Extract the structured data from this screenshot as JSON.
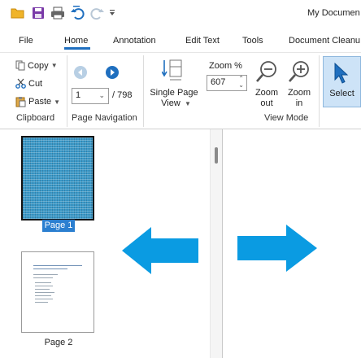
{
  "window": {
    "title": "My Documen"
  },
  "quick_access": [
    "open-folder-icon",
    "save-icon",
    "print-icon",
    "undo-icon",
    "redo-icon",
    "customize-toolbar-icon"
  ],
  "tabs": [
    {
      "label": "File"
    },
    {
      "label": "Home",
      "active": true
    },
    {
      "label": "Annotation"
    },
    {
      "label": "Edit Text"
    },
    {
      "label": "Tools"
    },
    {
      "label": "Document Cleanu"
    }
  ],
  "ribbon": {
    "clipboard": {
      "copy": "Copy",
      "cut": "Cut",
      "paste": "Paste",
      "label": "Clipboard"
    },
    "page_navigation": {
      "current_page": "1",
      "total": "/ 798",
      "label": "Page Navigation"
    },
    "view_mode": {
      "single_page_line1": "Single Page",
      "single_page_line2": "View",
      "zoom_label": "Zoom %",
      "zoom_value": "607",
      "zoom_out_line1": "Zoom",
      "zoom_out_line2": "out",
      "zoom_in_line1": "Zoom",
      "zoom_in_line2": "in",
      "label": "View Mode"
    },
    "select": "Select"
  },
  "thumbnails": [
    {
      "label": "Page 1",
      "selected": true
    },
    {
      "label": "Page 2",
      "selected": false
    }
  ],
  "colors": {
    "accent": "#1f6fbf",
    "arrow": "#0a9be2",
    "selection": "#2b7fd0"
  }
}
